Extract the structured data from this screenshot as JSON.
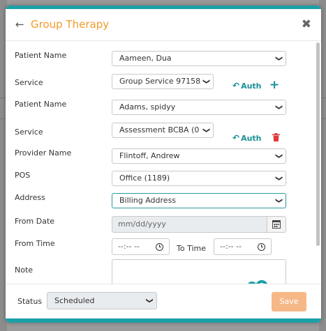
{
  "modal": {
    "title": "Group Therapy"
  },
  "form": {
    "patient1": {
      "label": "Patient Name",
      "value": "Aameen, Dua"
    },
    "service1": {
      "label": "Service",
      "value": "Group Service 97158",
      "auth": "Auth"
    },
    "patient2": {
      "label": "Patient Name",
      "value": "Adams, spidyy"
    },
    "service2": {
      "label": "Service",
      "value": "Assessment BCBA (0",
      "auth": "Auth"
    },
    "provider": {
      "label": "Provider Name",
      "value": "Flintoff, Andrew"
    },
    "pos": {
      "label": "POS",
      "value": "Office (1189)"
    },
    "address": {
      "label": "Address",
      "value": "Billing Address"
    },
    "from_date": {
      "label": "From Date",
      "placeholder": "mm/dd/yyyy"
    },
    "from_time": {
      "label": "From Time",
      "placeholder": "--:-- --"
    },
    "to_time": {
      "label": "To Time",
      "placeholder": "--:-- --"
    },
    "note": {
      "label": "Note"
    }
  },
  "footer": {
    "status_label": "Status",
    "status_value": "Scheduled",
    "save_label": "Save"
  },
  "colors": {
    "accent": "#1aa0a8",
    "title": "#f39a2b",
    "save": "#f7b888",
    "delete": "#e03a3a"
  }
}
